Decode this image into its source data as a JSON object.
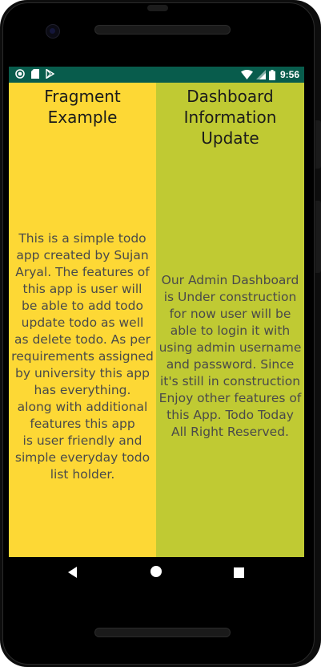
{
  "status_bar": {
    "time": "9:56",
    "left_icons": [
      "notification-dot-icon",
      "sd-card-icon",
      "play-store-icon"
    ],
    "right_icons": [
      "wifi-icon",
      "signal-icon",
      "battery-icon"
    ],
    "background_color": "#085c4c"
  },
  "fragments": {
    "left": {
      "title": "Fragment\nExample",
      "body": "This is a simple todo\napp created by Sujan\nAryal. The features of\nthis app is user will\nbe able to add todo\nupdate todo as well\nas delete todo. As per\nrequirements assigned\nby university this app\nhas everything.\nalong with additional\nfeatures this app\nis user friendly and\nsimple everyday todo\nlist holder.",
      "background_color": "#fdd835"
    },
    "right": {
      "title": "Dashboard\nInformation\nUpdate",
      "body": "Our Admin Dashboard\nis Under construction\nfor now user will be\nable to login it with\nusing admin username\nand password. Since\nit's still in construction\nEnjoy other features of\nthis App. Todo Today\nAll Right Reserved.",
      "background_color": "#c0ca33"
    }
  },
  "nav_bar": {
    "buttons": [
      "back-icon",
      "home-icon",
      "recents-icon"
    ]
  }
}
